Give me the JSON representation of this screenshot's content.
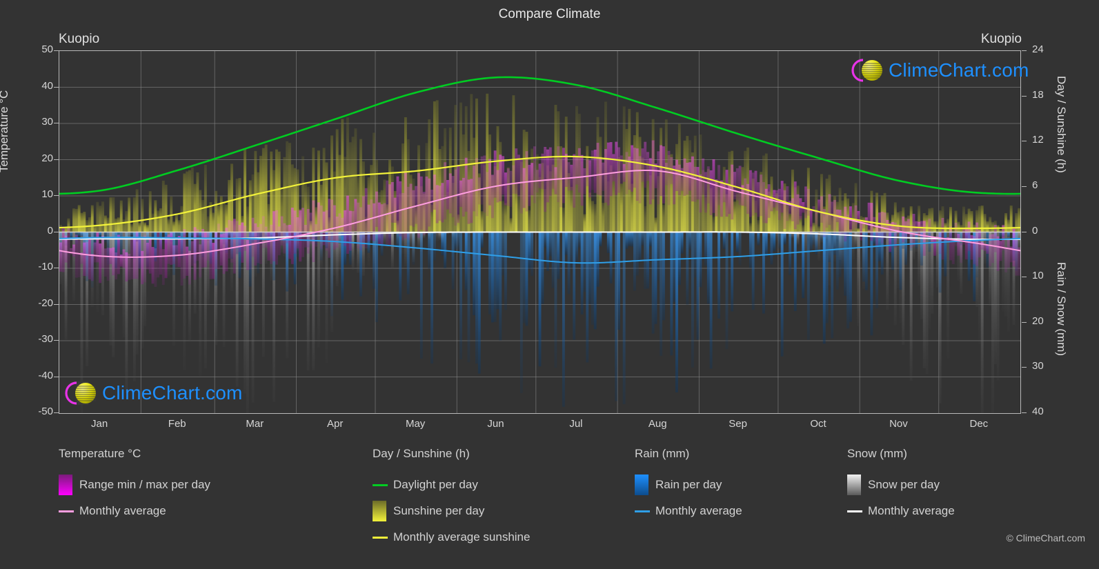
{
  "header": {
    "title": "Compare Climate",
    "location_left": "Kuopio",
    "location_right": "Kuopio"
  },
  "brand": {
    "name": "ClimeChart.com",
    "copyright": "© ClimeChart.com",
    "logo_icon": "climechart-logo-icon",
    "text_color": "#1e90ff",
    "crescent_color": "#ff00ff",
    "sphere_color": "#e6e600"
  },
  "axes": {
    "left_title": "Temperature °C",
    "right_title_top": "Day / Sunshine (h)",
    "right_title_bottom": "Rain / Snow (mm)",
    "left_ticks": [
      "50",
      "40",
      "30",
      "20",
      "10",
      "0",
      "-10",
      "-20",
      "-30",
      "-40",
      "-50"
    ],
    "right_ticks_top": [
      "24",
      "18",
      "12",
      "6",
      "0"
    ],
    "right_ticks_bottom": [
      "10",
      "20",
      "30",
      "40"
    ],
    "x_ticks": [
      "Jan",
      "Feb",
      "Mar",
      "Apr",
      "May",
      "Jun",
      "Jul",
      "Aug",
      "Sep",
      "Oct",
      "Nov",
      "Dec"
    ]
  },
  "legend": {
    "groups": [
      {
        "title": "Temperature °C",
        "items": [
          {
            "label": "Range min / max per day",
            "mark": "swatch",
            "swatch_class": "sw-temp",
            "color": "#ff00ff"
          },
          {
            "label": "Monthly average",
            "mark": "line",
            "color": "#ff9ee0"
          }
        ]
      },
      {
        "title": "Day / Sunshine (h)",
        "items": [
          {
            "label": "Daylight per day",
            "mark": "line",
            "color": "#00cc22"
          },
          {
            "label": "Sunshine per day",
            "mark": "swatch",
            "swatch_class": "sw-sun",
            "color": "#f2f23a"
          },
          {
            "label": "Monthly average sunshine",
            "mark": "line",
            "color": "#f2f23a"
          }
        ]
      },
      {
        "title": "Rain (mm)",
        "items": [
          {
            "label": "Rain per day",
            "mark": "swatch",
            "swatch_class": "sw-rain",
            "color": "#1e90ff"
          },
          {
            "label": "Monthly average",
            "mark": "line",
            "color": "#2f9fe8"
          }
        ]
      },
      {
        "title": "Snow (mm)",
        "items": [
          {
            "label": "Snow per day",
            "mark": "swatch",
            "swatch_class": "sw-snow",
            "color": "#e8e8e8"
          },
          {
            "label": "Monthly average",
            "mark": "line",
            "color": "#ffffff"
          }
        ]
      }
    ]
  },
  "chart_data": {
    "type": "line",
    "title": "Compare Climate",
    "subtitle": "Kuopio",
    "xlabel": "",
    "ylabel": "Temperature °C",
    "ylabel_right_top": "Day / Sunshine (h)",
    "ylabel_right_bottom": "Rain / Snow (mm)",
    "ylim": [
      -50,
      50
    ],
    "ylim_right_top": [
      0,
      24
    ],
    "ylim_right_bottom": [
      0,
      40
    ],
    "grid": true,
    "legend_position": "below",
    "categories": [
      "Jan",
      "Feb",
      "Mar",
      "Apr",
      "May",
      "Jun",
      "Jul",
      "Aug",
      "Sep",
      "Oct",
      "Nov",
      "Dec"
    ],
    "series": [
      {
        "name": "Daylight per day",
        "unit": "h",
        "axis": "right_top",
        "color": "#00cc22",
        "values": [
          5.5,
          8.2,
          11.5,
          15.0,
          18.5,
          20.5,
          19.5,
          16.4,
          13.0,
          9.8,
          6.8,
          5.2
        ]
      },
      {
        "name": "Monthly average sunshine",
        "unit": "h",
        "axis": "right_top",
        "color": "#f2f23a",
        "values": [
          0.9,
          2.4,
          5.0,
          7.2,
          8.1,
          9.4,
          10.0,
          8.7,
          5.9,
          2.7,
          0.8,
          0.5
        ]
      },
      {
        "name": "Monthly average temperature",
        "unit": "°C",
        "axis": "left",
        "color": "#ff9ee0",
        "values": [
          -6.6,
          -6.4,
          -3.2,
          1.2,
          7.2,
          12.7,
          15.1,
          16.9,
          11.1,
          5.6,
          0.2,
          -3.2
        ]
      },
      {
        "name": "Monthly average rain",
        "unit": "mm",
        "axis": "right_bottom",
        "color": "#2f9fe8",
        "values": [
          1.2,
          1.3,
          1.5,
          2.1,
          3.5,
          5.2,
          6.8,
          6.1,
          5.4,
          4.1,
          2.8,
          1.8
        ]
      },
      {
        "name": "Monthly average snow",
        "unit": "mm",
        "axis": "right_bottom",
        "color": "#ffffff",
        "values": [
          1.5,
          1.5,
          1.3,
          0.6,
          0.1,
          0.0,
          0.0,
          0.0,
          0.0,
          0.4,
          1.2,
          1.6
        ]
      }
    ],
    "bands": [
      {
        "name": "Temperature range min / max per day",
        "unit": "°C",
        "axis": "left",
        "color": "#ff00ff",
        "min": [
          -11.0,
          -11.5,
          -8.0,
          -3.5,
          1.5,
          7.0,
          10.0,
          10.8,
          6.2,
          1.9,
          -2.8,
          -6.8
        ],
        "max": [
          -2.8,
          -2.5,
          1.8,
          7.0,
          14.0,
          19.5,
          21.0,
          22.0,
          15.5,
          8.8,
          2.6,
          -0.5
        ]
      },
      {
        "name": "Sunshine per day",
        "unit": "h",
        "axis": "right_top",
        "color": "#f2f23a",
        "min": [
          0,
          0,
          0,
          0,
          0,
          0,
          0,
          0,
          0,
          0,
          0,
          0
        ],
        "max": [
          4.5,
          8.0,
          11.5,
          14.5,
          17.0,
          18.0,
          17.5,
          15.0,
          11.5,
          8.0,
          4.5,
          3.5
        ]
      },
      {
        "name": "Rain per day",
        "unit": "mm",
        "axis": "right_bottom",
        "color": "#1e90ff",
        "min": [
          0,
          0,
          0,
          0,
          0,
          0,
          0,
          0,
          0,
          0,
          0,
          0
        ],
        "max": [
          12,
          12,
          14,
          18,
          26,
          32,
          38,
          36,
          30,
          24,
          20,
          14
        ]
      },
      {
        "name": "Snow per day",
        "unit": "mm",
        "axis": "right_bottom",
        "color": "#e8e8e8",
        "min": [
          0,
          0,
          0,
          0,
          0,
          0,
          0,
          0,
          0,
          0,
          0,
          0
        ],
        "max": [
          40,
          40,
          38,
          26,
          6,
          0,
          0,
          0,
          0,
          10,
          30,
          40
        ]
      }
    ]
  }
}
